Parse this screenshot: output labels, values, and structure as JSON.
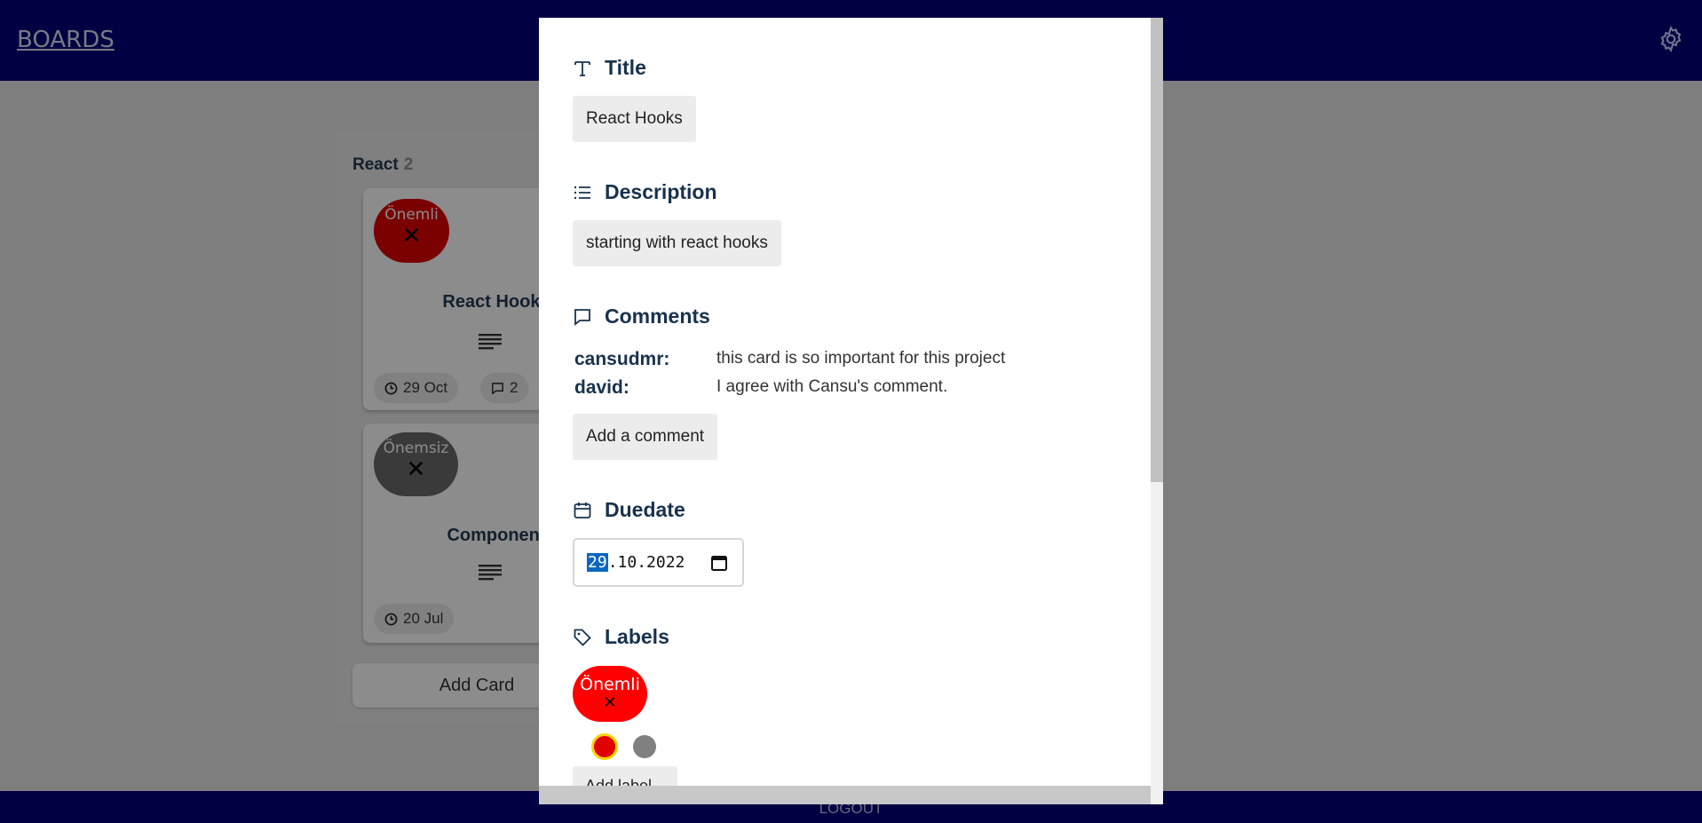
{
  "header": {
    "brand": "BOARDS",
    "settings_icon": "gear-icon"
  },
  "footer": {
    "logout": "LOGOUT"
  },
  "column": {
    "title": "React",
    "count": "2",
    "cards": [
      {
        "label": "Önemli",
        "label_color": "#ff0000",
        "remove": "✕",
        "title": "React Hooks",
        "date": "29 Oct",
        "comments": "2"
      },
      {
        "label": "Önemsiz",
        "label_color": "#6b6b6b",
        "remove": "✕",
        "title": "Component",
        "date": "20 Jul"
      }
    ],
    "add_card": "Add Card"
  },
  "modal": {
    "title_heading": "Title",
    "title_value": "React Hooks",
    "description_heading": "Description",
    "description_value": "starting with react hooks",
    "comments_heading": "Comments",
    "comments": [
      {
        "user": "cansudmr:",
        "text": "this card is so important for this project"
      },
      {
        "user": "david:",
        "text": "I agree with Cansu's comment."
      }
    ],
    "add_comment": "Add a comment",
    "duedate_heading": "Duedate",
    "duedate_day": "29",
    "duedate_rest": ".10.2022",
    "labels_heading": "Labels",
    "labels": [
      {
        "name": "Önemli",
        "remove": "✕",
        "color": "#ff0000"
      }
    ],
    "swatches": [
      "#e00000",
      "#808080"
    ],
    "add_label": "Add label"
  }
}
